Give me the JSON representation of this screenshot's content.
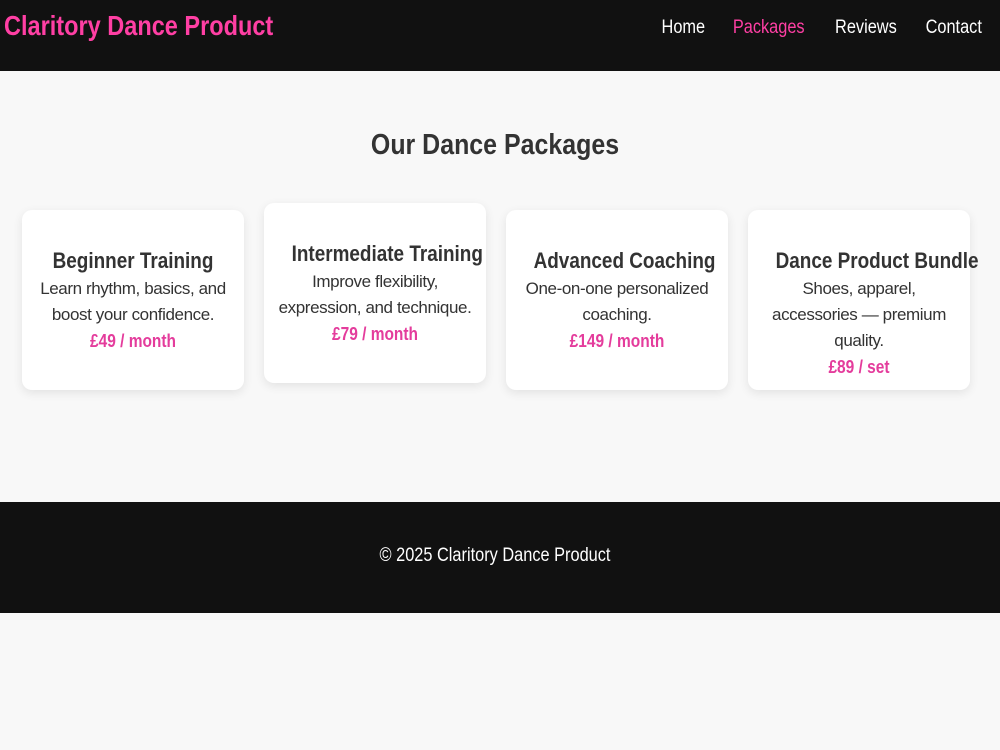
{
  "header": {
    "brand": "Claritory Dance Product",
    "nav": [
      {
        "label": "Home",
        "active": false
      },
      {
        "label": "Packages",
        "active": true
      },
      {
        "label": "Reviews",
        "active": false
      },
      {
        "label": "Contact",
        "active": false
      }
    ]
  },
  "main": {
    "title": "Our Dance Packages",
    "packages": [
      {
        "title": "Beginner Training",
        "description": "Learn rhythm, basics, and boost your confidence.",
        "price": "£49 / month"
      },
      {
        "title": "Intermediate Training",
        "description": "Improve flexibility, expression, and technique.",
        "price": "£79 / month"
      },
      {
        "title": "Advanced Coaching",
        "description": "One-on-one personalized coaching.",
        "price": "£149 / month"
      },
      {
        "title": "Dance Product Bundle",
        "description": "Shoes, apparel, accessories — premium quality.",
        "price": "£89 / set"
      }
    ]
  },
  "footer": {
    "copyright": "© 2025 Claritory Dance Product"
  },
  "colors": {
    "accent": "#ff3fa4",
    "header_bg": "#111111",
    "page_bg": "#f8f8f8"
  }
}
